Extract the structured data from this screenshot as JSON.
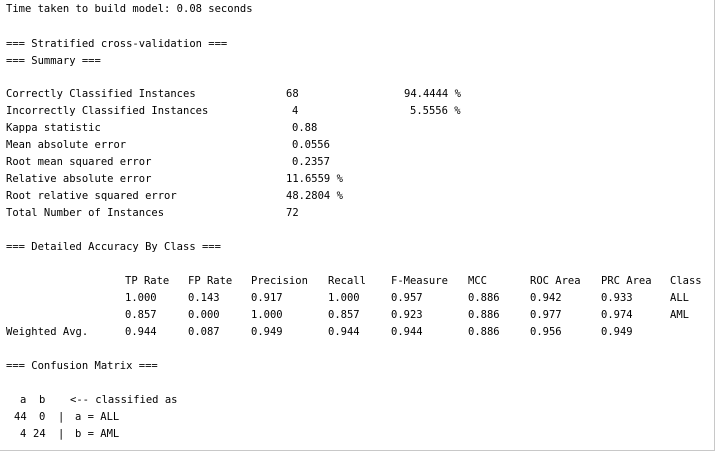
{
  "build_time": "Time taken to build model: 0.08 seconds",
  "cv_header": "=== Stratified cross-validation ===",
  "summary_header": "=== Summary ===",
  "summary": {
    "correct_label": "Correctly Classified Instances",
    "correct_value": "68",
    "correct_pct": "94.4444 %",
    "incorrect_label": "Incorrectly Classified Instances",
    "incorrect_value": "4",
    "incorrect_pct": "5.5556 %",
    "kappa_label": "Kappa statistic",
    "kappa_value": "0.88",
    "mae_label": "Mean absolute error",
    "mae_value": "0.0556",
    "rmse_label": "Root mean squared error",
    "rmse_value": "0.2357",
    "rae_label": "Relative absolute error",
    "rae_value": "11.6559 %",
    "rrse_label": "Root relative squared error",
    "rrse_value": "48.2804 %",
    "total_label": "Total Number of Instances",
    "total_value": "72"
  },
  "accuracy_header": "=== Detailed Accuracy By Class ===",
  "accuracy": {
    "headers": [
      "TP Rate",
      "FP Rate",
      "Precision",
      "Recall",
      "F-Measure",
      "MCC",
      "ROC Area",
      "PRC Area",
      "Class"
    ],
    "rows": [
      {
        "label": "",
        "values": [
          "1.000",
          "0.143",
          "0.917",
          "1.000",
          "0.957",
          "0.886",
          "0.942",
          "0.933",
          "ALL"
        ]
      },
      {
        "label": "",
        "values": [
          "0.857",
          "0.000",
          "1.000",
          "0.857",
          "0.923",
          "0.886",
          "0.977",
          "0.974",
          "AML"
        ]
      },
      {
        "label": "Weighted Avg.",
        "values": [
          "0.944",
          "0.087",
          "0.949",
          "0.944",
          "0.944",
          "0.886",
          "0.956",
          "0.949",
          ""
        ]
      }
    ]
  },
  "confusion_header": "=== Confusion Matrix ===",
  "confusion": {
    "col_a": "a",
    "col_b": "b",
    "classified_as": "<-- classified as",
    "rows": [
      {
        "a": "44",
        "b": "0",
        "sep": "|",
        "label": "a = ALL"
      },
      {
        "a": "4",
        "b": "24",
        "sep": "|",
        "label": "b = AML"
      }
    ]
  }
}
